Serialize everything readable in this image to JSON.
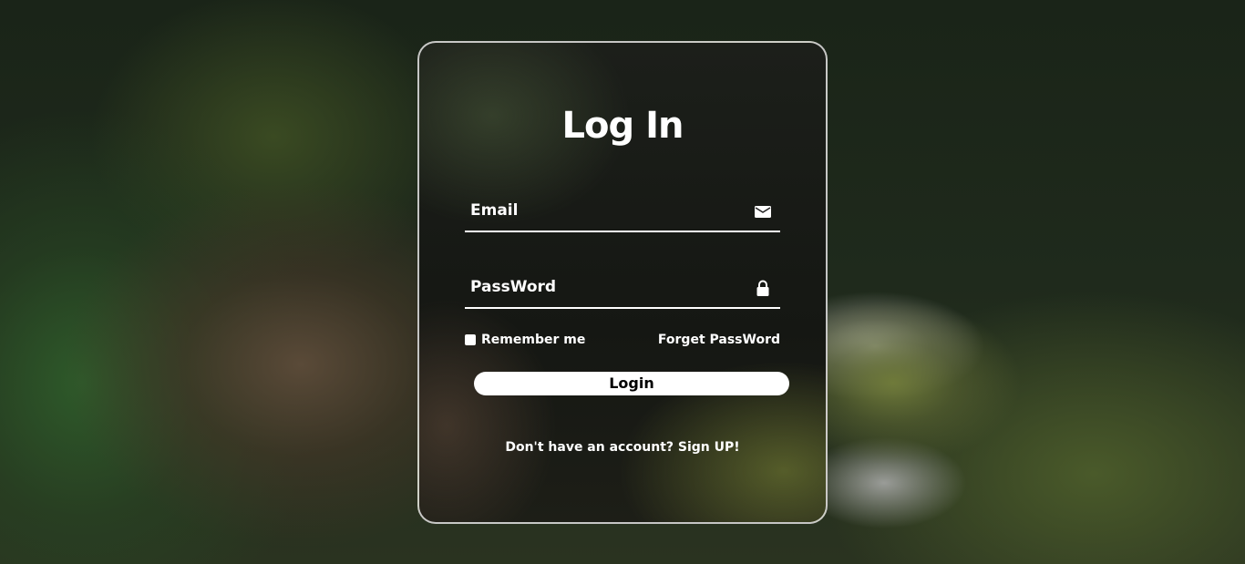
{
  "form": {
    "title": "Log In",
    "email_label": "Email",
    "password_label": "PassWord",
    "remember": "Remember me",
    "forgot": "Forget PassWord",
    "login": "Login",
    "signup_prompt": "Don't have an account?",
    "signup_link": "Sign UP!"
  }
}
